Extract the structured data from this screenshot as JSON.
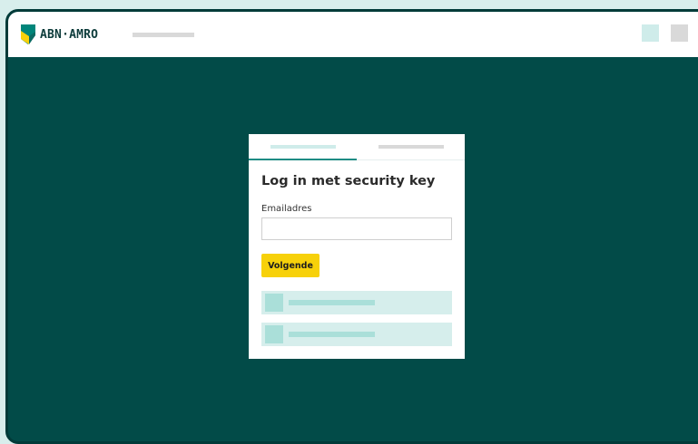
{
  "header": {
    "brand_name": "ABN·AMRO",
    "logo_icon": "abn-amro-shield-icon",
    "colors": {
      "logo_green": "#00857a",
      "logo_yellow": "#f7d10a",
      "page_background": "#024b48"
    }
  },
  "login_card": {
    "title": "Log in met security key",
    "email_label": "Emailadres",
    "email_value": "",
    "next_button_label": "Volgende",
    "button_color": "#f7d10a",
    "active_tab": 1
  }
}
